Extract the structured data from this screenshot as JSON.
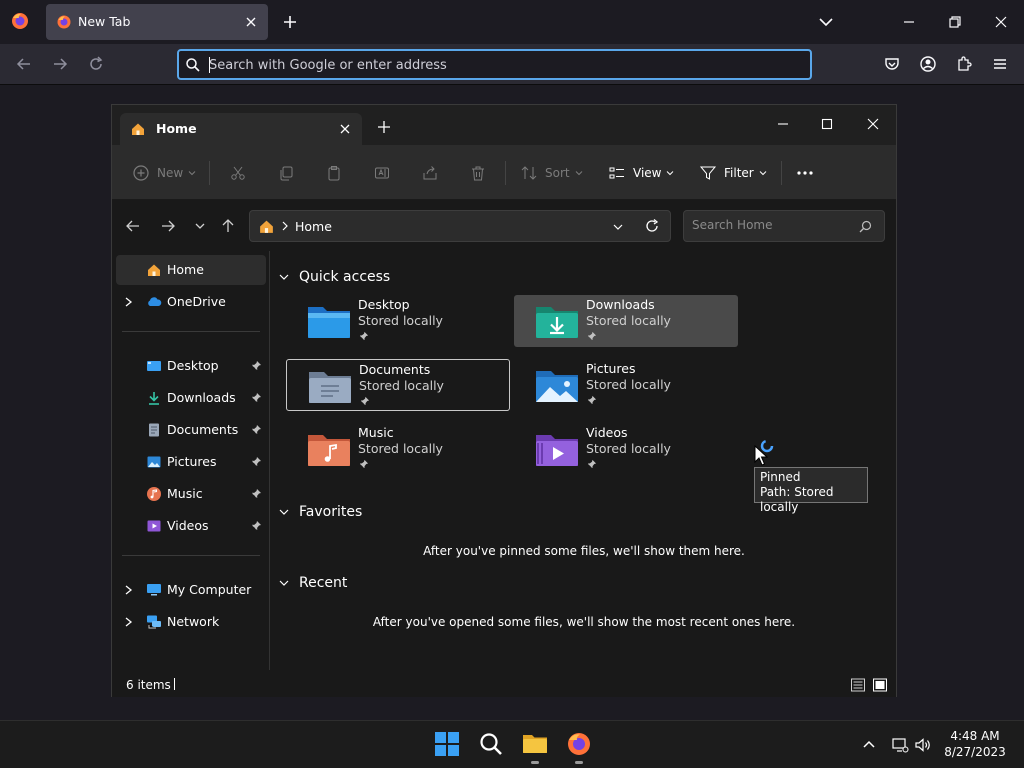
{
  "browser": {
    "tab_title": "New Tab",
    "url_placeholder": "Search with Google or enter address"
  },
  "explorer": {
    "tab_title": "Home",
    "toolbar": {
      "new_label": "New",
      "sort_label": "Sort",
      "view_label": "View",
      "filter_label": "Filter"
    },
    "address": {
      "crumb": "Home",
      "search_placeholder": "Search Home"
    },
    "nav": {
      "home": "Home",
      "onedrive": "OneDrive",
      "pinned": [
        "Desktop",
        "Downloads",
        "Documents",
        "Pictures",
        "Music",
        "Videos"
      ],
      "my_computer": "My Computer",
      "network": "Network"
    },
    "sections": {
      "quick_access": "Quick access",
      "favorites": "Favorites",
      "recent": "Recent"
    },
    "quick_access": [
      {
        "name": "Desktop",
        "status": "Stored locally",
        "color": "#2b8fe0"
      },
      {
        "name": "Downloads",
        "status": "Stored locally",
        "color": "#23b39b"
      },
      {
        "name": "Documents",
        "status": "Stored locally",
        "color": "#8b9cb3"
      },
      {
        "name": "Pictures",
        "status": "Stored locally",
        "color": "#2d88d8"
      },
      {
        "name": "Music",
        "status": "Stored locally",
        "color": "#e6734f"
      },
      {
        "name": "Videos",
        "status": "Stored locally",
        "color": "#8f56d6"
      }
    ],
    "favorites_empty": "After you've pinned some files, we'll show them here.",
    "recent_empty": "After you've opened some files, we'll show the most recent ones here.",
    "tooltip": {
      "line1": "Pinned",
      "line2": "Path: Stored locally"
    },
    "status": {
      "item_count": "6 items"
    }
  },
  "taskbar": {
    "time": "4:48 AM",
    "date": "8/27/2023"
  },
  "colors": {
    "accent": "#5aa7ea",
    "folder_yellow": "#f5c540",
    "firefox_orange": "#ff7139",
    "windows_blue": "#3aa0f3"
  }
}
